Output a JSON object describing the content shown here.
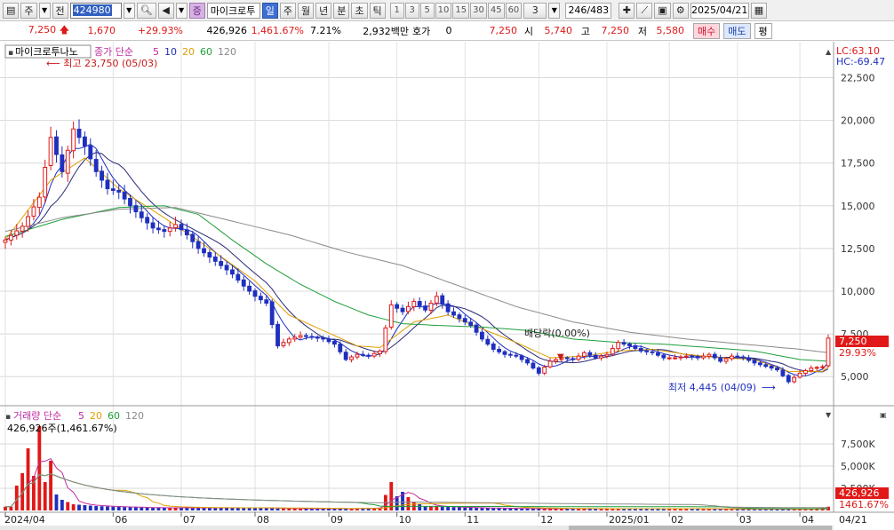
{
  "toolbar": {
    "market_label": "주",
    "period_label": "전",
    "code": "424980",
    "stock_name": "마이크로투",
    "category_label": "증",
    "period_buttons": [
      "일",
      "주",
      "월",
      "년",
      "분",
      "초",
      "틱"
    ],
    "period_selected": "일",
    "interval_buttons": [
      "1",
      "3",
      "5",
      "10",
      "15",
      "30",
      "45",
      "60"
    ],
    "interval_value": "3",
    "count": "246/483",
    "date": "2025/04/21"
  },
  "quote": {
    "price": "7,250",
    "change": "1,670",
    "change_pct": "+29.93%",
    "volume": "426,926",
    "volume_ratio": "1,461.67%",
    "turnover": "7.21%",
    "amount": "2,932백만",
    "hoga_label": "호가",
    "hoga_value": "0",
    "ask": "7,250",
    "open_label": "시",
    "open": "5,740",
    "high_label": "고",
    "high": "7,250",
    "low_label": "저",
    "low": "5,580",
    "buy_label": "매수",
    "sell_label": "매도",
    "avg_label": "평"
  },
  "price_panel": {
    "title": "마이크로투나노",
    "ma_label": "종가 단순",
    "ma_periods": [
      "5",
      "10",
      "20",
      "60",
      "120"
    ],
    "lc": "LC:63.10",
    "hc": "HC:-69.47",
    "high_annot": "최고 23,750 (05/03)",
    "low_annot": "최저 4,445 (04/09)",
    "dividend_annot": "배당락(0.00%)",
    "last_price": "7,250",
    "last_pct": "29.93%"
  },
  "volume_panel": {
    "title": "거래량 단순",
    "ma_periods": [
      "5",
      "20",
      "60",
      "120"
    ],
    "info": "426,926주(1,461.67%)",
    "last_volume": "426,926",
    "last_pct": "1461.67%"
  },
  "colors": {
    "up": "#e01818",
    "down": "#1f2fbf",
    "ma5": "#1f2fbf",
    "ma10": "#1f2fbf",
    "ma20": "#e0a000",
    "ma60": "#1f9e3a",
    "ma120": "#8a8a8a"
  },
  "chart_data": {
    "type": "candlestick",
    "price_axis_ticks": [
      "22,500",
      "20,000",
      "17,500",
      "15,000",
      "12,500",
      "10,000",
      "7,500",
      "5,000"
    ],
    "volume_axis_ticks": [
      "7,500K",
      "5,000K",
      "2,500K"
    ],
    "x_tick_labels": [
      "2024/04",
      "06",
      "07",
      "08",
      "09",
      "10",
      "11",
      "12",
      "2025/01",
      "02",
      "03",
      "04"
    ],
    "x_last_label": "04/21",
    "close_path": [
      [
        0,
        13000
      ],
      [
        3,
        13800
      ],
      [
        6,
        15500
      ],
      [
        8,
        19000
      ],
      [
        10,
        17000
      ],
      [
        12,
        19500
      ],
      [
        14,
        18500
      ],
      [
        16,
        17000
      ],
      [
        18,
        16000
      ],
      [
        20,
        15800
      ],
      [
        22,
        15000
      ],
      [
        24,
        14300
      ],
      [
        26,
        13700
      ],
      [
        28,
        13500
      ],
      [
        30,
        13900
      ],
      [
        32,
        13300
      ],
      [
        34,
        12500
      ],
      [
        36,
        12000
      ],
      [
        38,
        11500
      ],
      [
        40,
        11000
      ],
      [
        42,
        10300
      ],
      [
        44,
        9700
      ],
      [
        46,
        9300
      ],
      [
        48,
        6800
      ],
      [
        50,
        7200
      ],
      [
        52,
        7400
      ],
      [
        54,
        7300
      ],
      [
        56,
        7200
      ],
      [
        58,
        6900
      ],
      [
        60,
        6000
      ],
      [
        62,
        6300
      ],
      [
        64,
        6200
      ],
      [
        66,
        6500
      ],
      [
        68,
        9200
      ],
      [
        70,
        8800
      ],
      [
        72,
        9400
      ],
      [
        74,
        8900
      ],
      [
        76,
        9700
      ],
      [
        78,
        8800
      ],
      [
        80,
        8400
      ],
      [
        82,
        8000
      ],
      [
        84,
        7200
      ],
      [
        86,
        6600
      ],
      [
        88,
        6300
      ],
      [
        90,
        6200
      ],
      [
        92,
        5800
      ],
      [
        94,
        5200
      ],
      [
        96,
        5900
      ],
      [
        98,
        6100
      ],
      [
        100,
        6000
      ],
      [
        102,
        6400
      ],
      [
        104,
        6100
      ],
      [
        106,
        6300
      ],
      [
        108,
        7000
      ],
      [
        110,
        6800
      ],
      [
        112,
        6500
      ],
      [
        114,
        6400
      ],
      [
        116,
        6100
      ],
      [
        118,
        6100
      ],
      [
        120,
        6200
      ],
      [
        122,
        6100
      ],
      [
        124,
        6300
      ],
      [
        126,
        5900
      ],
      [
        128,
        6200
      ],
      [
        130,
        6100
      ],
      [
        132,
        5800
      ],
      [
        134,
        5600
      ],
      [
        136,
        5400
      ],
      [
        138,
        4700
      ],
      [
        140,
        5200
      ],
      [
        142,
        5500
      ],
      [
        144,
        5580
      ],
      [
        145,
        7250
      ]
    ],
    "ma20_path": [
      [
        0,
        13000
      ],
      [
        8,
        16500
      ],
      [
        14,
        17800
      ],
      [
        20,
        16000
      ],
      [
        28,
        14300
      ],
      [
        36,
        12500
      ],
      [
        44,
        10600
      ],
      [
        50,
        8600
      ],
      [
        56,
        7700
      ],
      [
        62,
        6800
      ],
      [
        66,
        6700
      ],
      [
        72,
        8200
      ],
      [
        78,
        8600
      ],
      [
        84,
        7800
      ],
      [
        90,
        7000
      ],
      [
        96,
        6100
      ],
      [
        102,
        6200
      ],
      [
        108,
        6500
      ],
      [
        114,
        6600
      ],
      [
        120,
        6300
      ],
      [
        126,
        6100
      ],
      [
        132,
        6000
      ],
      [
        138,
        5300
      ],
      [
        144,
        5300
      ],
      [
        145,
        5600
      ]
    ],
    "ma60_path": [
      [
        0,
        13200
      ],
      [
        10,
        14200
      ],
      [
        20,
        14900
      ],
      [
        28,
        15000
      ],
      [
        34,
        14500
      ],
      [
        40,
        13000
      ],
      [
        46,
        11600
      ],
      [
        52,
        10400
      ],
      [
        58,
        9400
      ],
      [
        64,
        8600
      ],
      [
        70,
        8100
      ],
      [
        76,
        8000
      ],
      [
        84,
        7900
      ],
      [
        92,
        7700
      ],
      [
        100,
        7200
      ],
      [
        108,
        7000
      ],
      [
        116,
        6900
      ],
      [
        124,
        6700
      ],
      [
        132,
        6500
      ],
      [
        140,
        6000
      ],
      [
        145,
        5900
      ]
    ],
    "ma120_path": [
      [
        0,
        13500
      ],
      [
        10,
        14300
      ],
      [
        20,
        14800
      ],
      [
        30,
        14900
      ],
      [
        40,
        14100
      ],
      [
        50,
        13300
      ],
      [
        60,
        12300
      ],
      [
        70,
        11500
      ],
      [
        80,
        10300
      ],
      [
        90,
        9100
      ],
      [
        100,
        8200
      ],
      [
        110,
        7600
      ],
      [
        120,
        7200
      ],
      [
        130,
        6900
      ],
      [
        140,
        6600
      ],
      [
        145,
        6400
      ]
    ],
    "volume_bars": [
      [
        2,
        2800
      ],
      [
        3,
        4200
      ],
      [
        4,
        7000
      ],
      [
        5,
        3900
      ],
      [
        6,
        9500
      ],
      [
        7,
        3200
      ],
      [
        8,
        5600
      ],
      [
        9,
        1800
      ],
      [
        10,
        1200
      ],
      [
        12,
        700
      ],
      [
        14,
        600
      ],
      [
        16,
        500
      ],
      [
        20,
        400
      ],
      [
        26,
        300
      ],
      [
        34,
        300
      ],
      [
        44,
        300
      ],
      [
        50,
        200
      ],
      [
        60,
        200
      ],
      [
        66,
        300
      ],
      [
        68,
        3200
      ],
      [
        69,
        1600
      ],
      [
        70,
        2100
      ],
      [
        72,
        900
      ],
      [
        74,
        500
      ],
      [
        78,
        400
      ],
      [
        82,
        300
      ],
      [
        92,
        200
      ],
      [
        100,
        200
      ],
      [
        110,
        200
      ],
      [
        120,
        200
      ],
      [
        130,
        150
      ],
      [
        140,
        150
      ],
      [
        144,
        300
      ],
      [
        145,
        427
      ]
    ]
  }
}
